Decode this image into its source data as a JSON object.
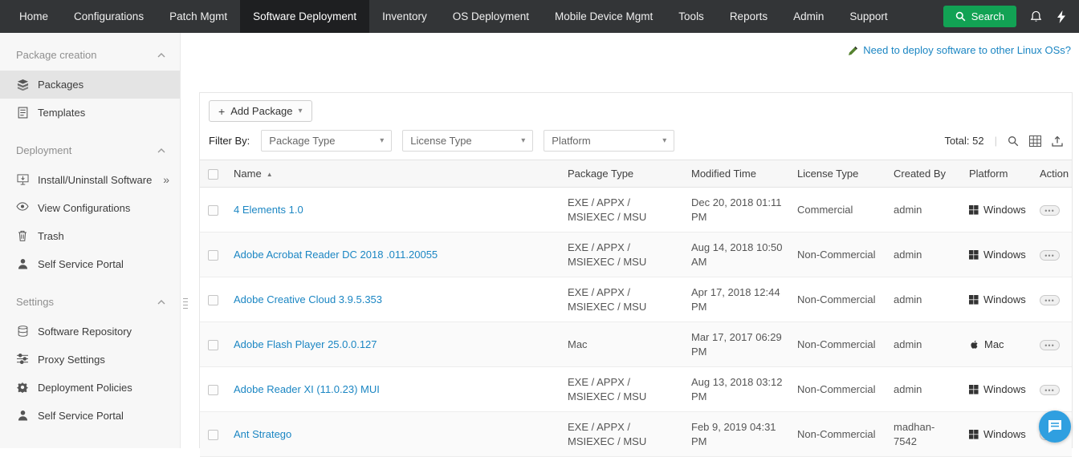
{
  "icons": {
    "plus": "+",
    "caret_down": "▾",
    "sort_asc": "▲",
    "double_arrow": "»",
    "ellipsis": "•••",
    "separator": "|"
  },
  "navbar": {
    "items": [
      "Home",
      "Configurations",
      "Patch Mgmt",
      "Software Deployment",
      "Inventory",
      "OS Deployment",
      "Mobile Device Mgmt",
      "Tools",
      "Reports",
      "Admin",
      "Support"
    ],
    "search_label": "Search"
  },
  "sidebar": {
    "sections": [
      {
        "title": "Package creation",
        "items": [
          {
            "label": "Packages"
          },
          {
            "label": "Templates"
          }
        ]
      },
      {
        "title": "Deployment",
        "items": [
          {
            "label": "Install/Uninstall Software"
          },
          {
            "label": "View Configurations"
          },
          {
            "label": "Trash"
          },
          {
            "label": "Self Service Portal"
          }
        ]
      },
      {
        "title": "Settings",
        "items": [
          {
            "label": "Software Repository"
          },
          {
            "label": "Proxy Settings"
          },
          {
            "label": "Deployment Policies"
          },
          {
            "label": "Self Service Portal"
          }
        ]
      }
    ]
  },
  "main": {
    "deploy_link_label": "Need to deploy software to other Linux OSs?",
    "add_package_label": "Add Package",
    "filter_by_label": "Filter By:",
    "filters": {
      "package_type": "Package Type",
      "license_type": "License Type",
      "platform": "Platform"
    },
    "total_label": "Total: 52",
    "table": {
      "headers": {
        "name": "Name",
        "package_type": "Package Type",
        "modified_time": "Modified Time",
        "license_type": "License Type",
        "created_by": "Created By",
        "platform": "Platform",
        "action": "Action"
      },
      "rows": [
        {
          "name": "4 Elements 1.0",
          "package_type": "EXE / APPX / MSIEXEC / MSU",
          "modified_time": "Dec 20, 2018 01:11 PM",
          "license_type": "Commercial",
          "created_by": "admin",
          "platform": "Windows"
        },
        {
          "name": "Adobe Acrobat Reader DC 2018 .011.20055",
          "package_type": "EXE / APPX / MSIEXEC / MSU",
          "modified_time": "Aug 14, 2018 10:50 AM",
          "license_type": "Non-Commercial",
          "created_by": "admin",
          "platform": "Windows"
        },
        {
          "name": "Adobe Creative Cloud 3.9.5.353",
          "package_type": "EXE / APPX / MSIEXEC / MSU",
          "modified_time": "Apr 17, 2018 12:44 PM",
          "license_type": "Non-Commercial",
          "created_by": "admin",
          "platform": "Windows"
        },
        {
          "name": "Adobe Flash Player 25.0.0.127",
          "package_type": "Mac",
          "modified_time": "Mar 17, 2017 06:29 PM",
          "license_type": "Non-Commercial",
          "created_by": "admin",
          "platform": "Mac"
        },
        {
          "name": "Adobe Reader XI (11.0.23) MUI",
          "package_type": "EXE / APPX / MSIEXEC / MSU",
          "modified_time": "Aug 13, 2018 03:12 PM",
          "license_type": "Non-Commercial",
          "created_by": "admin",
          "platform": "Windows"
        },
        {
          "name": "Ant Stratego",
          "package_type": "EXE / APPX / MSIEXEC / MSU",
          "modified_time": "Feb 9, 2019 04:31 PM",
          "license_type": "Non-Commercial",
          "created_by": "madhan-7542",
          "platform": "Windows"
        }
      ]
    }
  },
  "colors": {
    "navbar_bg": "#333537",
    "accent_green": "#12a254",
    "link_blue": "#1b86c3",
    "chat_blue": "#2f9fe0"
  }
}
